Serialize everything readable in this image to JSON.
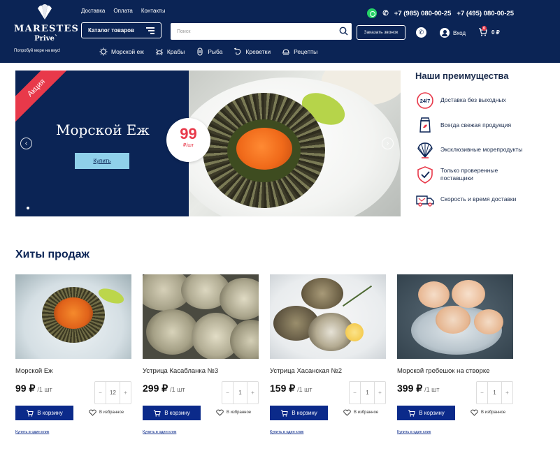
{
  "header": {
    "logo": {
      "name": "MARESTES",
      "sub": "Prive`",
      "tagline": "Попробуй море на вкус!"
    },
    "topnav": [
      "Доставка",
      "Оплата",
      "Контакты"
    ],
    "phones": [
      "+7 (985) 080-00-25",
      "+7 (495) 080-00-25"
    ],
    "catalog_label": "Каталог товаров",
    "search_placeholder": "Поиск",
    "callback_label": "Заказать звонок",
    "login_label": "Вход",
    "cart_total": "0 ₽",
    "cart_count": "0",
    "categories": [
      {
        "label": "Морской еж",
        "icon": "urchin-icon"
      },
      {
        "label": "Крабы",
        "icon": "crab-icon"
      },
      {
        "label": "Рыба",
        "icon": "fish-icon"
      },
      {
        "label": "Креветки",
        "icon": "shrimp-icon"
      },
      {
        "label": "Рецепты",
        "icon": "dish-icon"
      }
    ]
  },
  "hero": {
    "badge": "Акция",
    "title": "Морской Еж",
    "buy_label": "Купить",
    "price": "99",
    "price_unit": "₽/шт",
    "prev_icon": "arrow-left-icon",
    "next_icon": "arrow-right-icon"
  },
  "advantages": {
    "title": "Наши преимущества",
    "items": [
      {
        "text": "Доставка без выходных",
        "icon": "24-7-icon"
      },
      {
        "text": "Всегда свежая продукция",
        "icon": "fresh-package-icon"
      },
      {
        "text": "Эксклюзивные морепродукты",
        "icon": "shell-icon"
      },
      {
        "text": "Только проверенные поставщики",
        "icon": "shield-check-icon"
      },
      {
        "text": "Скорость и время доставки",
        "icon": "truck-icon"
      }
    ]
  },
  "hits": {
    "title": "Хиты продаж",
    "products": [
      {
        "name": "Морской Еж",
        "price": "99 ₽",
        "unit": "/1 шт",
        "qty": "12",
        "cart_label": "В корзину",
        "fav_label": "В избранное",
        "oneclick_label": "Купить в один клик"
      },
      {
        "name": "Устрица Касабланка №3",
        "price": "299 ₽",
        "unit": "/1 шт",
        "qty": "1",
        "cart_label": "В корзину",
        "fav_label": "В избранное",
        "oneclick_label": "Купить в один клик"
      },
      {
        "name": "Устрица Хасанская №2",
        "price": "159 ₽",
        "unit": "/1 шт",
        "qty": "1",
        "cart_label": "В корзину",
        "fav_label": "В избранное",
        "oneclick_label": "Купить в один клик"
      },
      {
        "name": "Морской гребешок на створке",
        "price": "399 ₽",
        "unit": "/1 шт",
        "qty": "1",
        "cart_label": "В корзину",
        "fav_label": "В избранное",
        "oneclick_label": "Купить в один клик"
      }
    ]
  },
  "colors": {
    "brand_navy": "#0b2455",
    "accent_red": "#e8394a",
    "button_blue": "#0b2a8a",
    "hero_button": "#8fd0ea"
  }
}
